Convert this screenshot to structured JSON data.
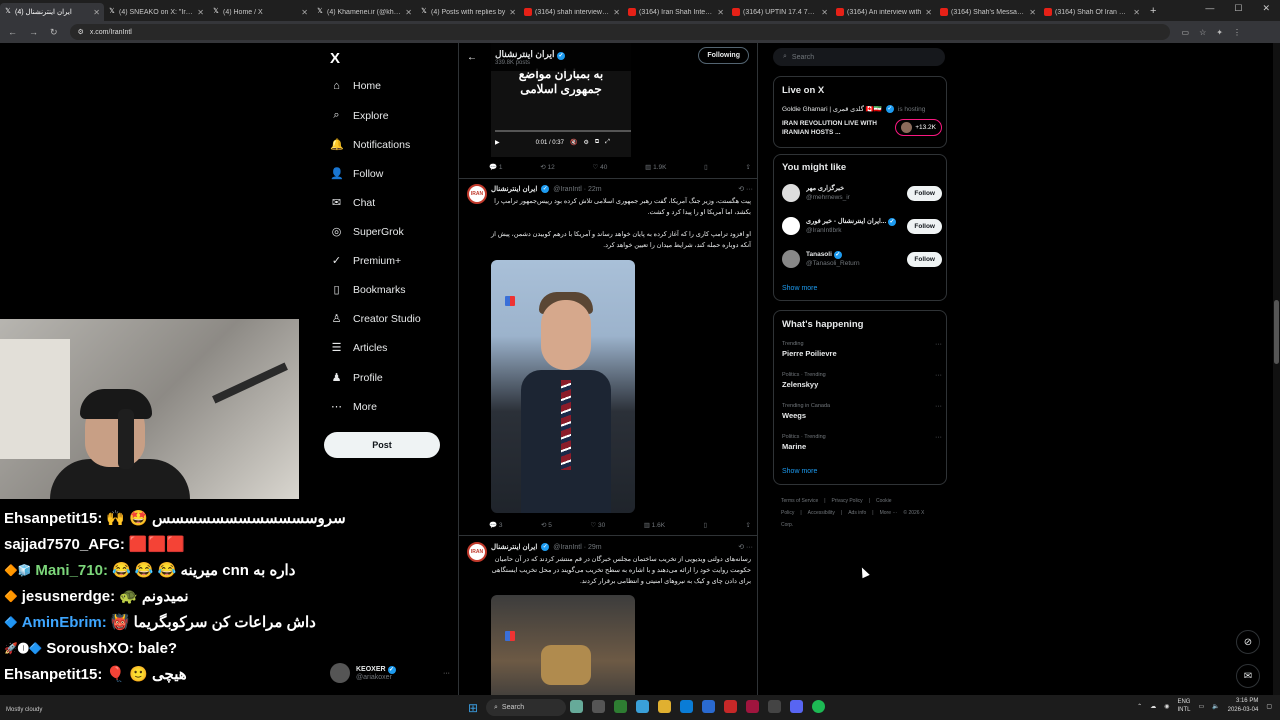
{
  "browser": {
    "tabs": [
      {
        "title": "(4) ایران اینترنشنال",
        "icon": "x",
        "active": true
      },
      {
        "title": "(4) SNEAKO on X: \"Iranian",
        "icon": "x",
        "active": false
      },
      {
        "title": "(4) Home / X",
        "icon": "x",
        "active": false
      },
      {
        "title": "(4) Khamenei.ir (@khamen",
        "icon": "x",
        "active": false
      },
      {
        "title": "(4) Posts with replies by ",
        "icon": "x",
        "active": false
      },
      {
        "title": "(3164) shah interview bla",
        "icon": "youtube",
        "active": false
      },
      {
        "title": "(3164) Iran Shah Interview",
        "icon": "youtube",
        "active": false
      },
      {
        "title": "(3164) UPTIN 17.4 78 PH",
        "icon": "youtube",
        "active": false
      },
      {
        "title": "(3164) An interview with",
        "icon": "youtube",
        "active": false
      },
      {
        "title": "(3164) Shah's Message to",
        "icon": "youtube",
        "active": false
      },
      {
        "title": "(3164) Shah Of Iran Critic",
        "icon": "youtube",
        "active": false
      }
    ],
    "url": "x.com/IranIntl"
  },
  "leftnav": {
    "logo": "X",
    "items": [
      {
        "label": "Home",
        "icon": "home-icon",
        "glyph": "⌂"
      },
      {
        "label": "Explore",
        "icon": "search-icon",
        "glyph": "⌕"
      },
      {
        "label": "Notifications",
        "icon": "bell-icon",
        "glyph": "🔔"
      },
      {
        "label": "Follow",
        "icon": "person-plus-icon",
        "glyph": "👤"
      },
      {
        "label": "Chat",
        "icon": "chat-icon",
        "glyph": "✉"
      },
      {
        "label": "SuperGrok",
        "icon": "grok-icon",
        "glyph": "◎"
      },
      {
        "label": "Premium+",
        "icon": "premium-icon",
        "glyph": "✓"
      },
      {
        "label": "Bookmarks",
        "icon": "bookmark-icon",
        "glyph": "▯"
      },
      {
        "label": "Creator Studio",
        "icon": "creator-icon",
        "glyph": "♙"
      },
      {
        "label": "Articles",
        "icon": "articles-icon",
        "glyph": "☰"
      },
      {
        "label": "Profile",
        "icon": "profile-icon",
        "glyph": "♟"
      },
      {
        "label": "More",
        "icon": "more-icon",
        "glyph": "⋯"
      }
    ],
    "post_label": "Post",
    "account": {
      "name": "KEOXER",
      "handle": "@ariakoxer"
    }
  },
  "chat": [
    {
      "user": "Ehsanpetit15:",
      "msg": "سروسسسسسسسسسسسس 🤩 🙌",
      "color": "c1",
      "badges": ""
    },
    {
      "user": "sajjad7570_AFG:",
      "msg": "🟥🟥🟥",
      "color": "c1",
      "badges": ""
    },
    {
      "user": "Mani_710:",
      "msg": "داره به cnn میرینه 😂 😂 😂",
      "color": "c3",
      "badges": "🔶🧊"
    },
    {
      "user": "jesusnerdge:",
      "msg": "نمیدونم 🐢",
      "color": "c1",
      "badges": "🔶"
    },
    {
      "user": "AminEbrim:",
      "msg": "داش مراعات کن سرکوبگریما 👹",
      "color": "c2",
      "badges": "🔷"
    },
    {
      "user": "SoroushXO:",
      "msg": "bale?",
      "color": "c1",
      "badges": "🚀🅘🔷"
    },
    {
      "user": "Ehsanpetit15:",
      "msg": "هیچی 🙂 🎈",
      "color": "c1",
      "badges": ""
    }
  ],
  "timeline": {
    "header_name": "ایران اینترنشنال",
    "header_sub": "339.8K posts",
    "following_label": "Following",
    "video_caption": "به بمباران مواضع جمهوری اسلامی",
    "video_time": "0:01 / 0:37",
    "tweet0_actions": {
      "replies": "1",
      "reposts": "12",
      "likes": "40",
      "views": "1.9K"
    },
    "tweet1": {
      "name": "ایران اینترنشنال",
      "handle": "@IranIntl · 22m",
      "text1": "پیت هگستت، وزیر جنگ آمریکا، گفت رهبر جمهوری اسلامی تلاش کرده بود رییس‌جمهور ترامپ را بکشد، اما آمریکا او را پیدا کرد و کشت.",
      "text2": "او افزود ترامپ کاری را که آغاز کرده به پایان خواهد رساند و آمریکا با درهم کوبیدن دشمن، پیش از آنکه دوباره حمله کند، شرایط میدان را تعیین خواهد کرد.",
      "actions": {
        "replies": "3",
        "reposts": "5",
        "likes": "30",
        "views": "1.6K"
      }
    },
    "tweet2": {
      "name": "ایران اینترنشنال",
      "handle": "@IranIntl · 29m",
      "text": "رسانه‌های دولتی ویدیویی از تخریب ساختمان مجلس خبرگان در قم منتشر کردند که در آن حامیان حکومت روایت خود را ارائه می‌دهند و با اشاره به سطح تخریب می‌گویند در محل تخریب ایستگاهی برای دادن چای و کیک به نیروهای امنیتی و انتظامی برقرار کردند."
    }
  },
  "right": {
    "search_placeholder": "Search",
    "live": {
      "title": "Live on X",
      "host": "Goldie Ghamari | گلدی قمری 🇨🇦🇮🇷",
      "host_suffix": "is hosting",
      "stream": "IRAN REVOLUTION LIVE WITH IRANIAN HOSTS ...",
      "count": "+13.2K"
    },
    "might_like": {
      "title": "You might like",
      "items": [
        {
          "name": "خبرگزاری مهر",
          "handle": "@mehrnews_ir",
          "verified": false,
          "color": "#ddd"
        },
        {
          "name": "ایران اینترنشنال - خبر فوری...",
          "handle": "@IranIntlbrk",
          "verified": true,
          "color": "#fff"
        },
        {
          "name": "Tanasoli",
          "handle": "@Tanasoli_Return",
          "verified": true,
          "color": "#888"
        }
      ],
      "follow_label": "Follow",
      "show_more": "Show more"
    },
    "happening": {
      "title": "What's happening",
      "items": [
        {
          "ctx": "Trending",
          "topic": "Pierre Poilievre"
        },
        {
          "ctx": "Politics · Trending",
          "topic": "Zelenskyy"
        },
        {
          "ctx": "Trending in Canada",
          "topic": "Weegs"
        },
        {
          "ctx": "Politics · Trending",
          "topic": "Marine"
        }
      ],
      "show_more": "Show more"
    },
    "footer": [
      "Terms of Service",
      "|",
      "Privacy Policy",
      "|",
      "Cookie Policy",
      "|",
      "Accessibility",
      "|",
      "Ads info",
      "|",
      "More ···",
      "© 2026 X Corp."
    ]
  },
  "taskbar": {
    "weather": "Mostly cloudy",
    "search_label": "Search",
    "lang": "ENG",
    "lang2": "INTL",
    "time": "3:16 PM",
    "date": "2026-03-04"
  }
}
